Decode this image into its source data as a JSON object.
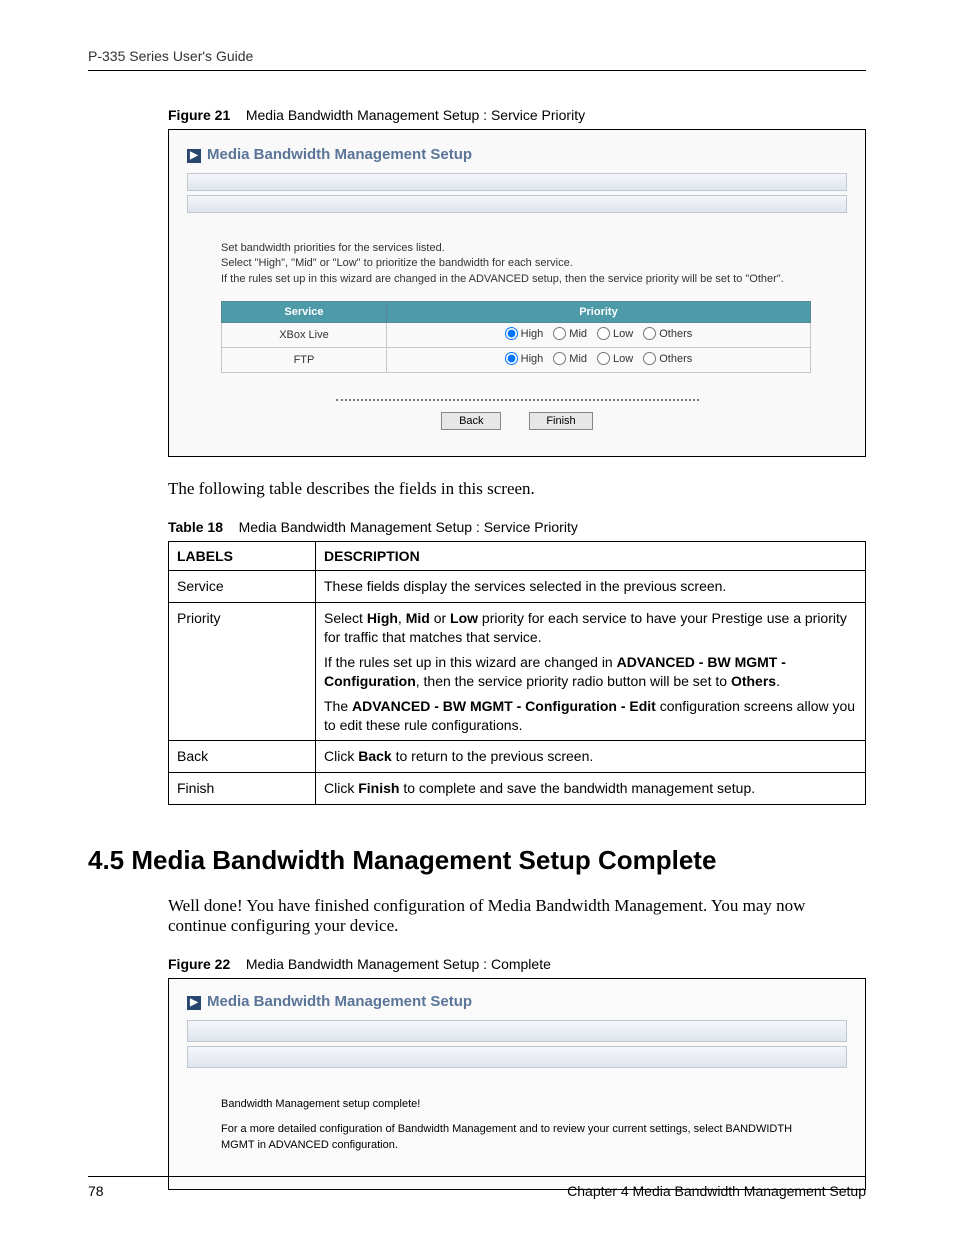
{
  "header": {
    "guide_title": "P-335 Series User's Guide"
  },
  "figure21": {
    "label": "Figure 21",
    "caption": "Media Bandwidth Management Setup : Service Priority",
    "panel_title": "Media Bandwidth Management Setup",
    "help_l1": "Set bandwidth priorities for the services listed.",
    "help_l2": "Select \"High\", \"Mid\" or \"Low\" to prioritize the bandwidth for each service.",
    "help_l3": "If the rules set up in this wizard are changed in the ADVANCED setup, then the service priority will be set to \"Other\".",
    "col_service": "Service",
    "col_priority": "Priority",
    "rows": [
      {
        "service": "XBox Live",
        "selected": "High"
      },
      {
        "service": "FTP",
        "selected": "High"
      }
    ],
    "opt_high": "High",
    "opt_mid": "Mid",
    "opt_low": "Low",
    "opt_others": "Others",
    "btn_back": "Back",
    "btn_finish": "Finish"
  },
  "intro_text": "The following table describes the fields in this screen.",
  "table18": {
    "label": "Table 18",
    "caption": "Media Bandwidth Management Setup : Service Priority",
    "head_labels": "LABELS",
    "head_desc": "DESCRIPTION",
    "rows": {
      "service": {
        "label": "Service",
        "desc": "These fields display the services selected in the previous screen."
      },
      "priority": {
        "label": "Priority",
        "p1a": "Select ",
        "p1b": "High",
        "p1c": ", ",
        "p1d": "Mid",
        "p1e": " or ",
        "p1f": "Low",
        "p1g": " priority for each service to have your Prestige use a priority for traffic that matches that service.",
        "p2a": "If the rules set up in this wizard are changed in ",
        "p2b": "ADVANCED - BW MGMT - Configuration",
        "p2c": ", then the service priority radio button will be set to ",
        "p2d": "Others",
        "p2e": ".",
        "p3a": "The ",
        "p3b": "ADVANCED - BW MGMT - Configuration - Edit",
        "p3c": " configuration screens allow you to edit these rule configurations."
      },
      "back": {
        "label": "Back",
        "d1": "Click ",
        "d2": "Back",
        "d3": " to return to the previous screen."
      },
      "finish": {
        "label": "Finish",
        "d1": "Click ",
        "d2": "Finish",
        "d3": " to complete and save the bandwidth management setup."
      }
    }
  },
  "section45": {
    "heading": "4.5  Media Bandwidth Management Setup Complete",
    "body": "Well done! You have finished configuration of Media Bandwidth Management. You may now continue configuring your device."
  },
  "figure22": {
    "label": "Figure 22",
    "caption": "Media Bandwidth Management Setup : Complete",
    "panel_title": "Media Bandwidth Management Setup",
    "msg": "Bandwidth Management setup complete!",
    "detail": "For a more detailed configuration of Bandwidth Management and to review your current settings, select BANDWIDTH MGMT in ADVANCED configuration."
  },
  "footer": {
    "page_no": "78",
    "chapter": "Chapter 4 Media Bandwidth Management Setup"
  }
}
